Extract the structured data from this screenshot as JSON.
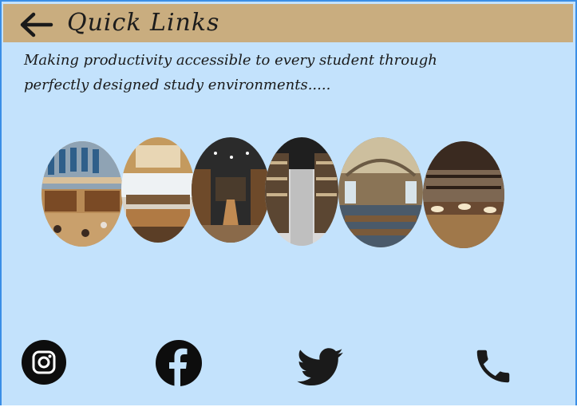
{
  "header": {
    "back_icon": "arrow-left-icon",
    "title": "Quick Links"
  },
  "tagline": "Making productivity accessible to every student through perfectly designed study environments.....",
  "gallery": {
    "images": [
      "library-atrium-photo",
      "library-skylight-hall-photo",
      "library-dark-ceiling-reading-tables-photo",
      "library-tall-bookshelves-aisle-photo",
      "library-grand-domed-reading-room-photo",
      "library-classic-reading-room-lamps-photo"
    ]
  },
  "social": {
    "icons": [
      "instagram-icon",
      "facebook-icon",
      "twitter-icon",
      "phone-icon"
    ]
  },
  "colors": {
    "page_background": "#c3e2fc",
    "header_background": "#c9ad7f",
    "border": "#3a8ee6",
    "icon": "#1a1a1a"
  }
}
